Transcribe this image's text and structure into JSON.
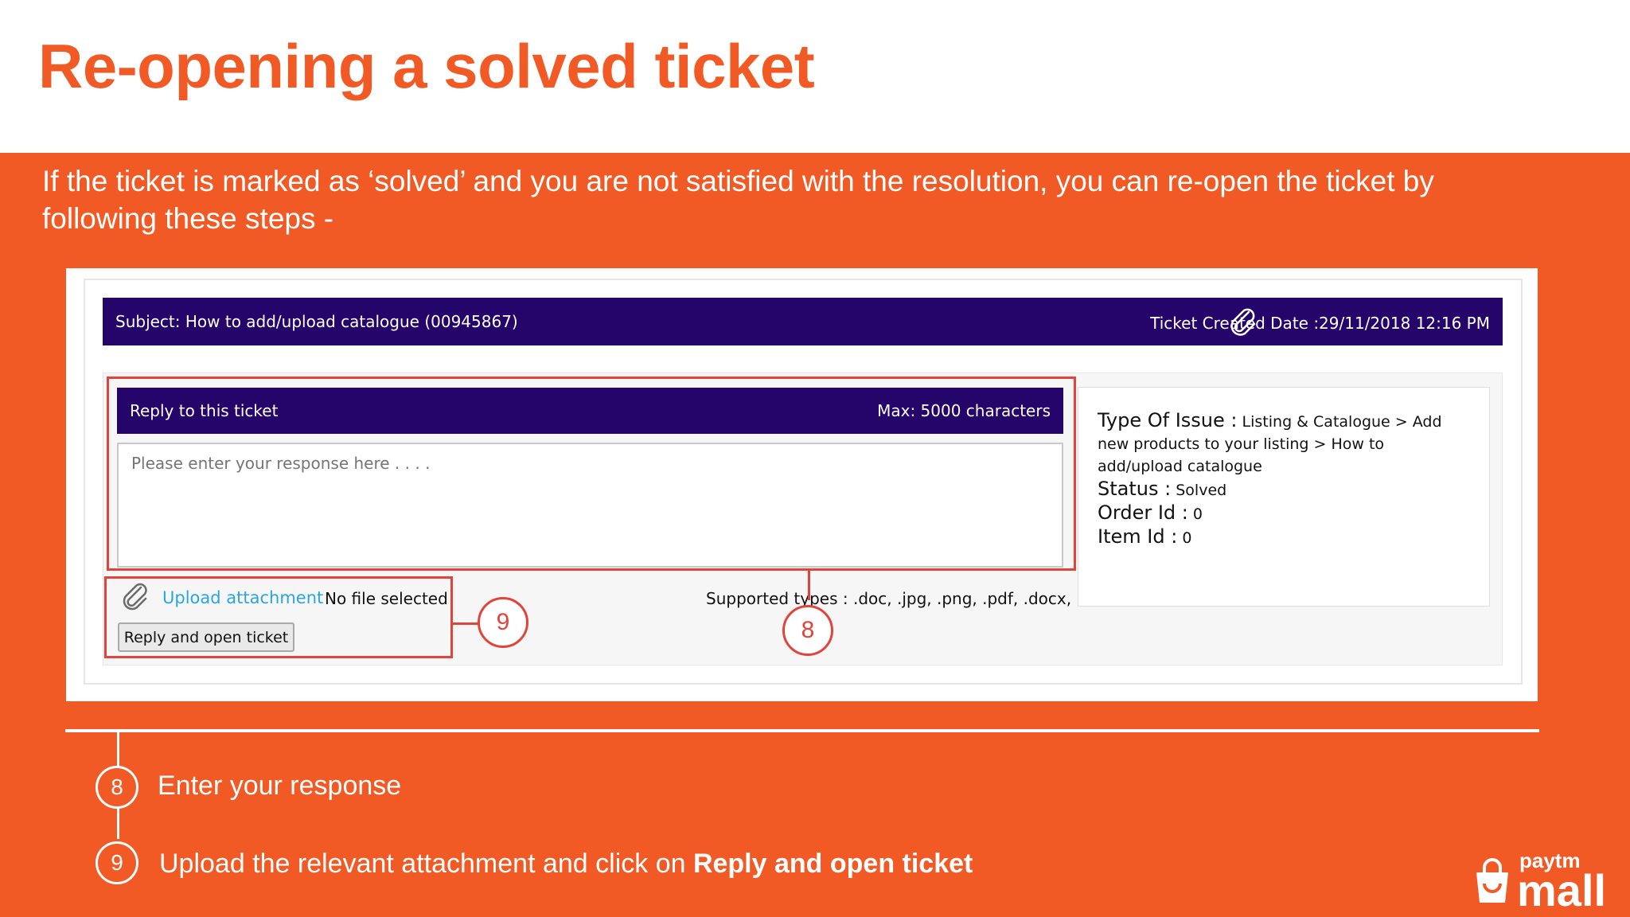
{
  "slide": {
    "title": "Re-opening a solved ticket",
    "intro": "If the ticket is marked as ‘solved’ and you are not satisfied with the resolution, you can re-open the ticket by following these steps -"
  },
  "ticket": {
    "subject": "Subject: How to add/upload catalogue (00945867)",
    "created": "Ticket Created Date :29/11/2018 12:16 PM",
    "reply_title": "Reply to this ticket",
    "reply_max": "Max: 5000 characters",
    "response_placeholder": "Please enter your response here . . . .",
    "upload_link": "Upload attachment",
    "no_file": "No file selected",
    "supported_types": "Supported types : .doc, .jpg, .png, .pdf, .docx, .csv",
    "reply_button": "Reply and open ticket",
    "info": {
      "type_label": "Type Of Issue :",
      "type_value": "Listing & Catalogue > Add new products to your listing > How to add/upload catalogue",
      "status_label": "Status :",
      "status_value": "Solved",
      "order_label": "Order Id :",
      "order_value": "0",
      "item_label": "Item Id :",
      "item_value": "0"
    }
  },
  "callouts": {
    "eight": "8",
    "nine": "9"
  },
  "steps": [
    {
      "number": "8",
      "text": "Enter your response"
    },
    {
      "number": "9",
      "text": "Upload the relevant attachment and click on ",
      "bold": "Reply and open ticket"
    }
  ],
  "logo": {
    "top": "paytm",
    "bottom": "mall"
  },
  "colors": {
    "brand_orange": "#f15a24",
    "header_purple": "#26056b",
    "highlight_red": "#e0443a",
    "link_blue": "#2aa6e0"
  },
  "icons": [
    "paperclip-icon",
    "shopping-bag-icon"
  ]
}
